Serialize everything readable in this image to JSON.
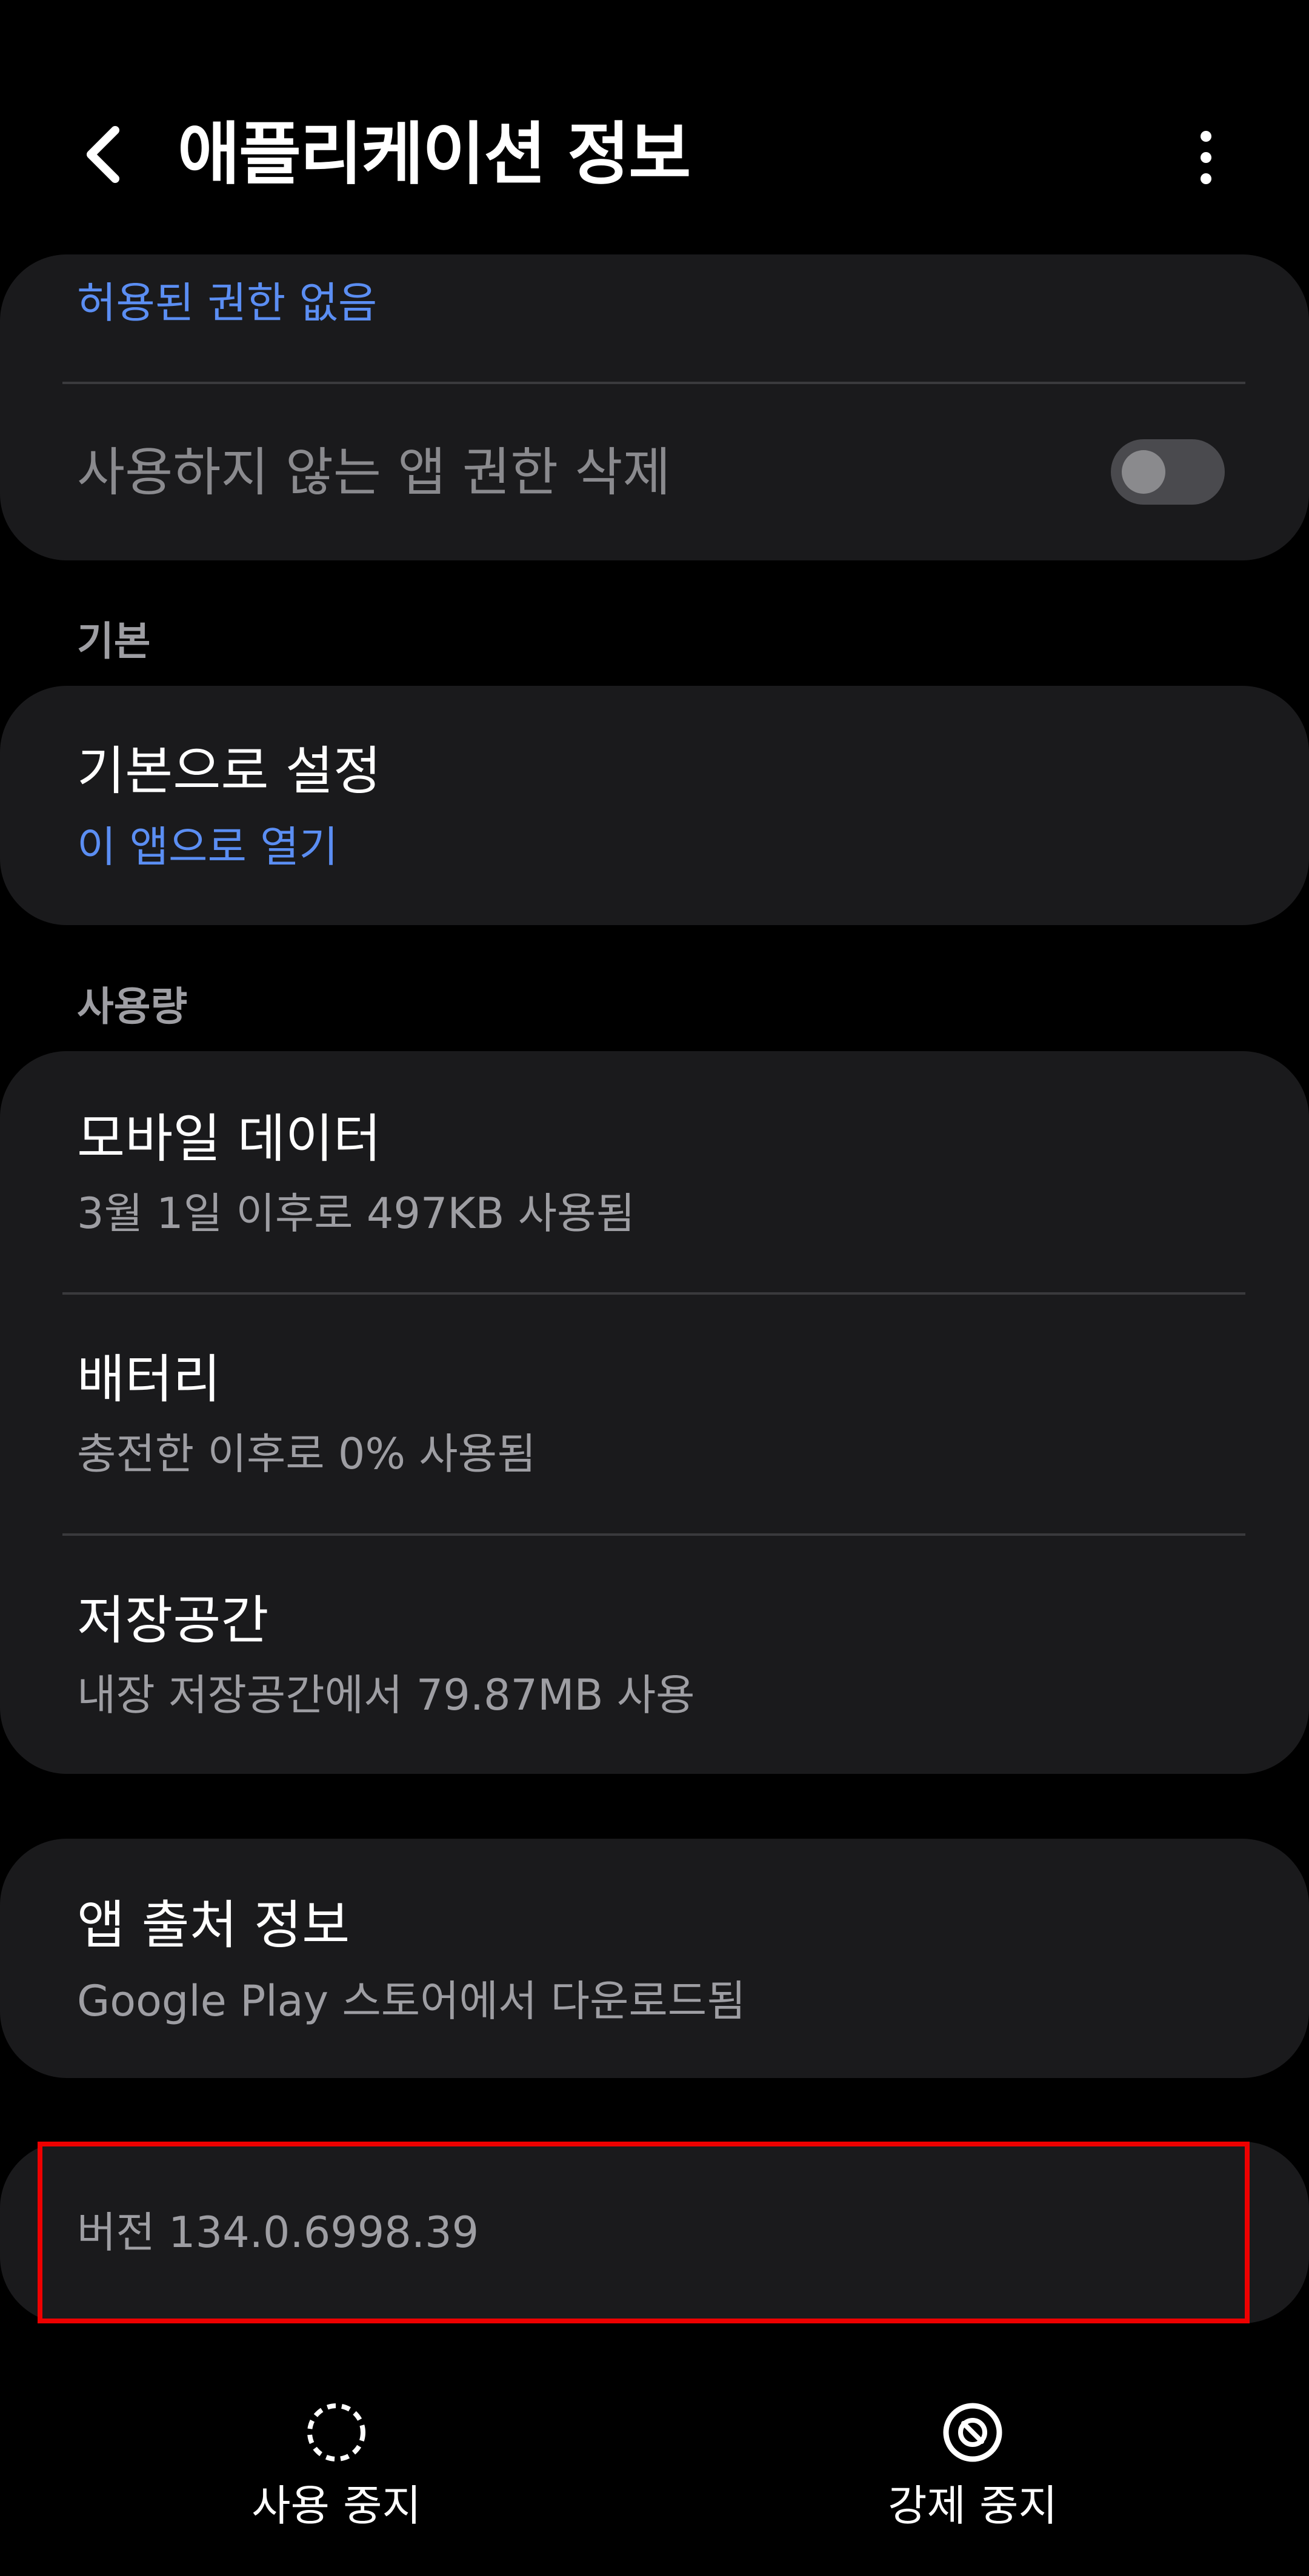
{
  "header": {
    "title": "애플리케이션 정보"
  },
  "permissions_card": {
    "permissions_status": "허용된 권한 없음",
    "remove_permissions_label": "사용하지 않는 앱 권한 삭제",
    "remove_permissions_enabled": false
  },
  "sections": {
    "default_label": "기본",
    "usage_label": "사용량"
  },
  "default_card": {
    "title": "기본으로 설정",
    "subtitle": "이 앱으로 열기"
  },
  "usage_card": {
    "mobile_data_title": "모바일 데이터",
    "mobile_data_subtitle": "3월 1일 이후로 497KB 사용됨",
    "battery_title": "배터리",
    "battery_subtitle": "충전한 이후로 0% 사용됨",
    "storage_title": "저장공간",
    "storage_subtitle": "내장 저장공간에서 79.87MB 사용"
  },
  "source_card": {
    "title": "앱 출처 정보",
    "subtitle": "Google Play 스토어에서 다운로드됨"
  },
  "version_card": {
    "text": "버전 134.0.6998.39"
  },
  "bottom_bar": {
    "disable_label": "사용 중지",
    "force_stop_label": "강제 중지"
  },
  "colors": {
    "accent_blue": "#5b8ef3",
    "highlight_red": "#e00000"
  },
  "icons": {
    "back": "back-chevron-icon",
    "more": "more-vert-icon",
    "disable": "dashed-circle-icon",
    "force_stop": "stop-circle-icon"
  }
}
